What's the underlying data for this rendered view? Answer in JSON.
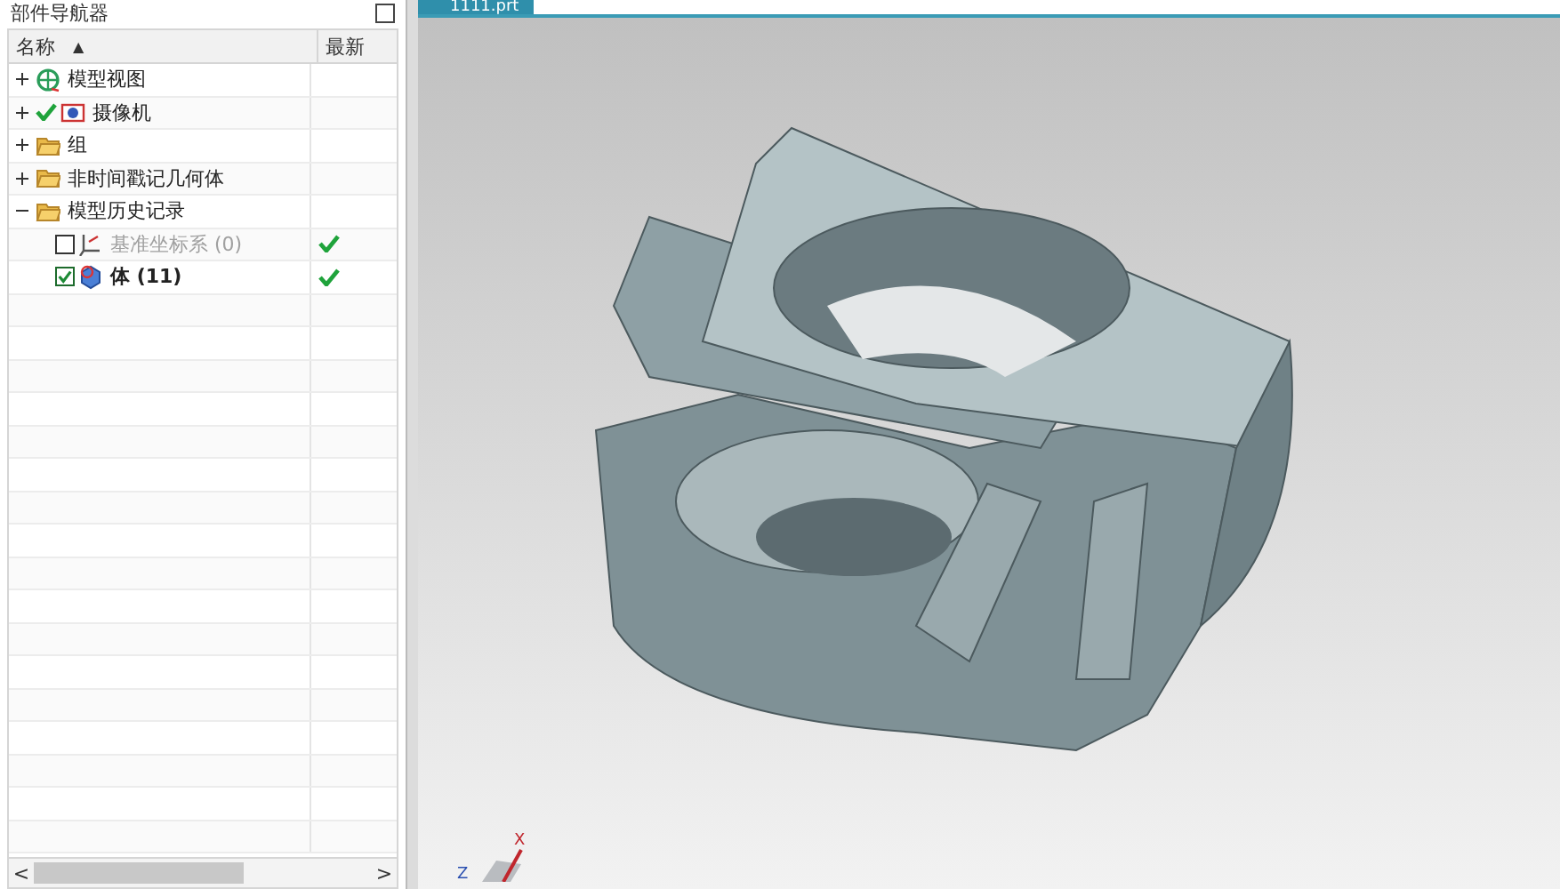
{
  "navigator": {
    "title": "部件导航器",
    "columns": [
      {
        "label": "名称",
        "sort": "▲"
      },
      {
        "label": "最新"
      }
    ],
    "items": [
      {
        "kind": "view",
        "label": "模型视图",
        "expanded": false,
        "marked": false
      },
      {
        "kind": "camera",
        "label": "摄像机",
        "expanded": false,
        "marked": true
      },
      {
        "kind": "folder",
        "label": "组",
        "expanded": false,
        "marked": false
      },
      {
        "kind": "folder",
        "label": "非时间戳记几何体",
        "expanded": false,
        "marked": false
      },
      {
        "kind": "folder",
        "label": "模型历史记录",
        "expanded": true,
        "marked": false,
        "children": [
          {
            "kind": "datum",
            "label": "基准坐标系 (0)",
            "checked": false,
            "disabled": true,
            "current": false,
            "latest": true
          },
          {
            "kind": "body",
            "label": "体 (11)",
            "checked": true,
            "disabled": false,
            "current": true,
            "latest": true
          }
        ]
      }
    ],
    "scroll_left": "<",
    "scroll_right": ">"
  },
  "viewport": {
    "tab": {
      "label": "1111.prt",
      "selected": true
    },
    "axes": {
      "z": "Z",
      "x": "X"
    }
  }
}
